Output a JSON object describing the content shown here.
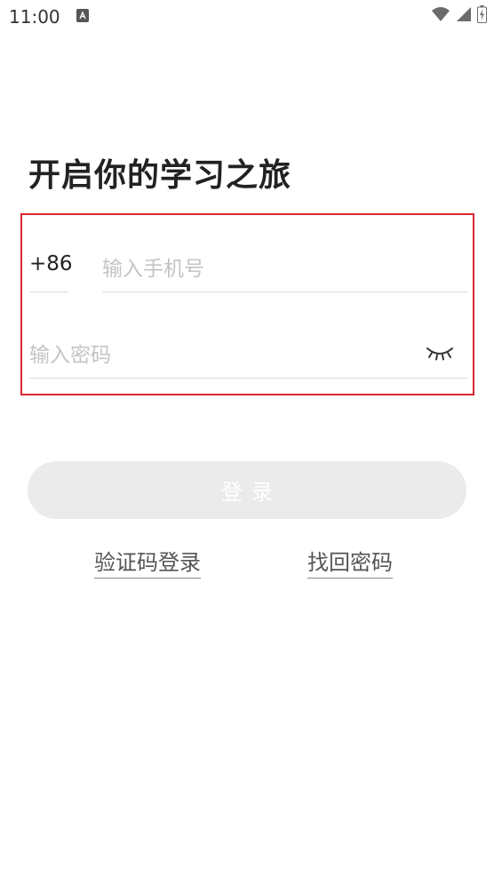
{
  "status_bar": {
    "time": "11:00",
    "icons": [
      "notification-a-icon",
      "wifi-icon",
      "signal-icon",
      "battery-icon"
    ]
  },
  "page": {
    "title": "开启你的学习之旅"
  },
  "form": {
    "country_code": "+86",
    "phone_placeholder": "输入手机号",
    "phone_value": "",
    "password_placeholder": "输入密码",
    "password_value": "",
    "password_toggle_icon": "eye-closed-icon",
    "highlight_color": "#d9282e"
  },
  "actions": {
    "login_label": "登录",
    "sms_login_label": "验证码登录",
    "forgot_password_label": "找回密码",
    "login_button_color": "#ebebeb"
  }
}
